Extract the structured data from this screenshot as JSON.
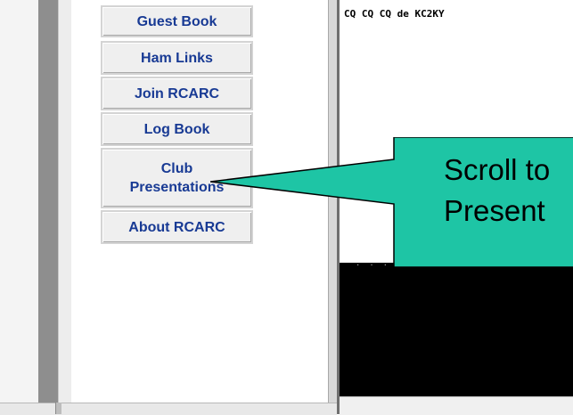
{
  "nav": {
    "items": [
      {
        "label": "Guest Book"
      },
      {
        "label": "Ham Links"
      },
      {
        "label": "Join RCARC"
      },
      {
        "label": "Log Book"
      },
      {
        "label": "Club Presentations",
        "line1": "Club",
        "line2": "Presentations"
      },
      {
        "label": "About RCARC"
      }
    ],
    "text_color": "#183a94"
  },
  "content": {
    "cq_message": "CQ CQ CQ de KC2KY"
  },
  "callout": {
    "line1": "Scroll to",
    "line2": "Present",
    "fill_color": "#1ec5a5"
  }
}
